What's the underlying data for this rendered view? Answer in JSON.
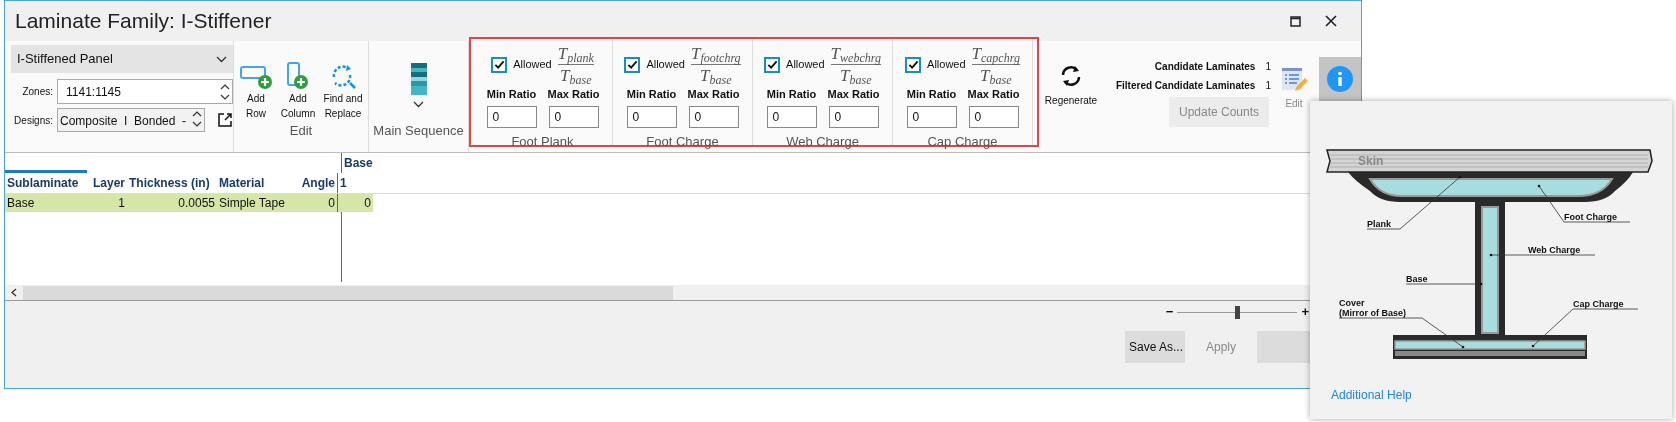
{
  "window": {
    "title": "Laminate Family: I-Stiffener"
  },
  "selector": {
    "value": "I-Stiffened Panel"
  },
  "zones": {
    "label": "Zones:",
    "value": "1141:1145"
  },
  "designs": {
    "label": "Designs:",
    "value": "Composite  I  Bonded  -"
  },
  "edit_group": {
    "label": "Edit",
    "buttons": [
      {
        "kind": "row",
        "label": "Add Row"
      },
      {
        "kind": "column",
        "label": "Add Column"
      },
      {
        "kind": "find",
        "label": "Find and Replace"
      }
    ]
  },
  "main_sequence": {
    "label": "Main Sequence"
  },
  "ratio_groups": [
    {
      "title": "Foot Plank",
      "allowed_label": "Allowed",
      "allowed": true,
      "numerator_symbol": "T",
      "denominator_symbol": "T",
      "numerator_sub": "plank",
      "denominator_sub": "base",
      "min_label": "Min Ratio",
      "max_label": "Max Ratio",
      "min": "0",
      "max": "0"
    },
    {
      "title": "Foot Charge",
      "allowed_label": "Allowed",
      "allowed": true,
      "numerator_symbol": "T",
      "denominator_symbol": "T",
      "numerator_sub": "footchrg",
      "denominator_sub": "base",
      "min_label": "Min Ratio",
      "max_label": "Max Ratio",
      "min": "0",
      "max": "0"
    },
    {
      "title": "Web Charge",
      "allowed_label": "Allowed",
      "allowed": true,
      "numerator_symbol": "T",
      "denominator_symbol": "T",
      "numerator_sub": "webchrg",
      "denominator_sub": "base",
      "min_label": "Min Ratio",
      "max_label": "Max Ratio",
      "min": "0",
      "max": "0"
    },
    {
      "title": "Cap Charge",
      "allowed_label": "Allowed",
      "allowed": true,
      "numerator_symbol": "T",
      "denominator_symbol": "T",
      "numerator_sub": "capchrg",
      "denominator_sub": "base",
      "min_label": "Min Ratio",
      "max_label": "Max Ratio",
      "min": "0",
      "max": "0"
    }
  ],
  "regenerate": {
    "label": "Regenerate"
  },
  "counts": [
    {
      "label": "Candidate Laminates",
      "value": "1"
    },
    {
      "label": "Filtered Candidate Laminates",
      "value": "1"
    }
  ],
  "update_button": {
    "label": "Update Counts",
    "disabled": true
  },
  "edit_button": {
    "label": "Edit",
    "disabled": true
  },
  "info_button": {
    "pressed": true
  },
  "table": {
    "group_header": "Base",
    "columns": [
      "Sublaminate",
      "Layer",
      "Thickness (in)",
      "Material",
      "Angle",
      "1"
    ],
    "rows": [
      {
        "cells": [
          "Base",
          "1",
          "0.0055",
          "Simple Tape",
          "0",
          "0"
        ],
        "selected": true
      }
    ]
  },
  "zoom": {
    "minus": "−",
    "plus": "+",
    "level": 0.5
  },
  "footer_buttons": [
    {
      "label": "Save As...",
      "disabled": false
    },
    {
      "label": "Apply",
      "disabled": true
    }
  ],
  "help_popup": {
    "labels": [
      "Skin",
      "Plank",
      "Foot Charge",
      "Web Charge",
      "Base",
      "Cover",
      "(Mirror of Base)",
      "Cap Charge"
    ],
    "link": "Additional Help"
  }
}
